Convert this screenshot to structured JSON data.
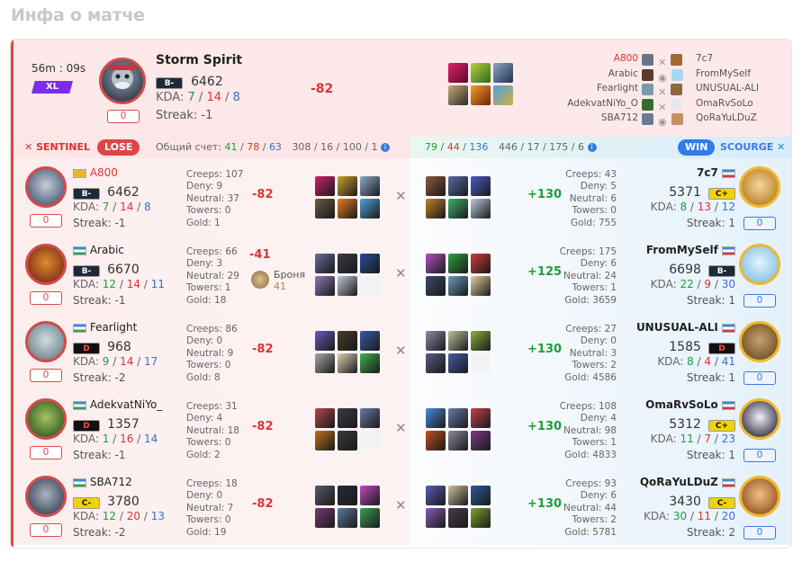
{
  "page_title": "Инфа о матче",
  "summary": {
    "duration": "56m : 09s",
    "badge": "XL",
    "hero": "Storm Spirit",
    "rank": "B-",
    "rating": "6462",
    "kda_label": "KDA:",
    "kda": [
      "7",
      "14",
      "8"
    ],
    "streak": "Streak: -1",
    "diff": "-82",
    "zero": "0",
    "list_left": [
      "A800",
      "Arabic",
      "Fearlight",
      "AdekvatNiYo_O",
      "SBA712"
    ],
    "list_right": [
      "7c7",
      "FromMySelf",
      "UNUSUAL-ALI",
      "OmaRvSoLo",
      "QoRaYuLDuZ"
    ]
  },
  "teams": {
    "sentinel": "SENTINEL",
    "lose": "LOSE",
    "score_label": "Общий счет:",
    "sent_score": [
      "41",
      "78",
      "63"
    ],
    "sent_extra": "308 / 16 / 100 / 1",
    "scour_score": [
      "79",
      "44",
      "136"
    ],
    "scour_extra": "446 / 17 / 175 / 6",
    "win": "WIN",
    "scourge": "SCOURGE"
  },
  "rows": [
    {
      "lname": "A800",
      "lrank": "B-",
      "lrating": "6462",
      "lkda": [
        "7",
        "14",
        "8"
      ],
      "lstreak": "Streak: -1",
      "lstats": [
        "Creeps: 107",
        "Deny: 9",
        "Neutral: 37",
        "Towers: 0",
        "Gold: 1"
      ],
      "ldiff": "-82",
      "rstats": [
        "Creeps: 43",
        "Deny: 5",
        "Neutral: 6",
        "Towers: 0",
        "Gold: 755"
      ],
      "rdiff": "+130",
      "rname": "7c7",
      "rrank": "C+",
      "rrating": "5371",
      "rkda": [
        "8",
        "13",
        "12"
      ],
      "rstreak": "Streak: 1"
    },
    {
      "lname": "Arabic",
      "lrank": "B-",
      "lrating": "6670",
      "lkda": [
        "12",
        "14",
        "11"
      ],
      "lstreak": "Streak: -1",
      "lstats": [
        "Creeps: 66",
        "Deny: 3",
        "Neutral: 29",
        "Towers: 1",
        "Gold: 18"
      ],
      "ldiff": "-41",
      "armor_label": "Броня",
      "armor_val": "41",
      "rstats": [
        "Creeps: 175",
        "Deny: 6",
        "Neutral: 24",
        "Towers: 1",
        "Gold: 3659"
      ],
      "rdiff": "+125",
      "rname": "FromMySelf",
      "rrank": "B-",
      "rrating": "6698",
      "rkda": [
        "22",
        "9",
        "30"
      ],
      "rstreak": "Streak: 1"
    },
    {
      "lname": "Fearlight",
      "lrank": "D",
      "lrating": "968",
      "lkda": [
        "9",
        "14",
        "17"
      ],
      "lstreak": "Streak: -2",
      "lstats": [
        "Creeps: 86",
        "Deny: 0",
        "Neutral: 9",
        "Towers: 0",
        "Gold: 8"
      ],
      "ldiff": "-82",
      "rstats": [
        "Creeps: 27",
        "Deny: 0",
        "Neutral: 3",
        "Towers: 2",
        "Gold: 4586"
      ],
      "rdiff": "+130",
      "rname": "UNUSUAL-ALI",
      "rrank": "D",
      "rrating": "1585",
      "rkda": [
        "8",
        "4",
        "41"
      ],
      "rstreak": "Streak: 1"
    },
    {
      "lname": "AdekvatNiYo_",
      "lrank": "D",
      "lrating": "1357",
      "lkda": [
        "1",
        "16",
        "14"
      ],
      "lstreak": "Streak: -1",
      "lstats": [
        "Creeps: 31",
        "Deny: 4",
        "Neutral: 18",
        "Towers: 0",
        "Gold: 2"
      ],
      "ldiff": "-82",
      "rstats": [
        "Creeps: 108",
        "Deny: 4",
        "Neutral: 98",
        "Towers: 1",
        "Gold: 4833"
      ],
      "rdiff": "+130",
      "rname": "OmaRvSoLo",
      "rrank": "C+",
      "rrating": "5312",
      "rkda": [
        "11",
        "7",
        "23"
      ],
      "rstreak": "Streak: 1"
    },
    {
      "lname": "SBA712",
      "lrank": "C-",
      "lrating": "3780",
      "lkda": [
        "12",
        "20",
        "13"
      ],
      "lstreak": "Streak: -2",
      "lstats": [
        "Creeps: 18",
        "Deny: 0",
        "Neutral: 7",
        "Towers: 0",
        "Gold: 19"
      ],
      "ldiff": "-82",
      "rstats": [
        "Creeps: 93",
        "Deny: 6",
        "Neutral: 44",
        "Towers: 2",
        "Gold: 5781"
      ],
      "rdiff": "+130",
      "rname": "QoRaYuLDuZ",
      "rrank": "C-",
      "rrating": "3430",
      "rkda": [
        "30",
        "11",
        "20"
      ],
      "rstreak": "Streak: 2"
    }
  ],
  "common": {
    "kda_label": "KDA:",
    "zero": "0",
    "sep": "/"
  },
  "colors": {
    "lose": "#e04545",
    "win": "#2f7de8",
    "sentinel": "#d33",
    "scourge": "#3a7be0"
  }
}
